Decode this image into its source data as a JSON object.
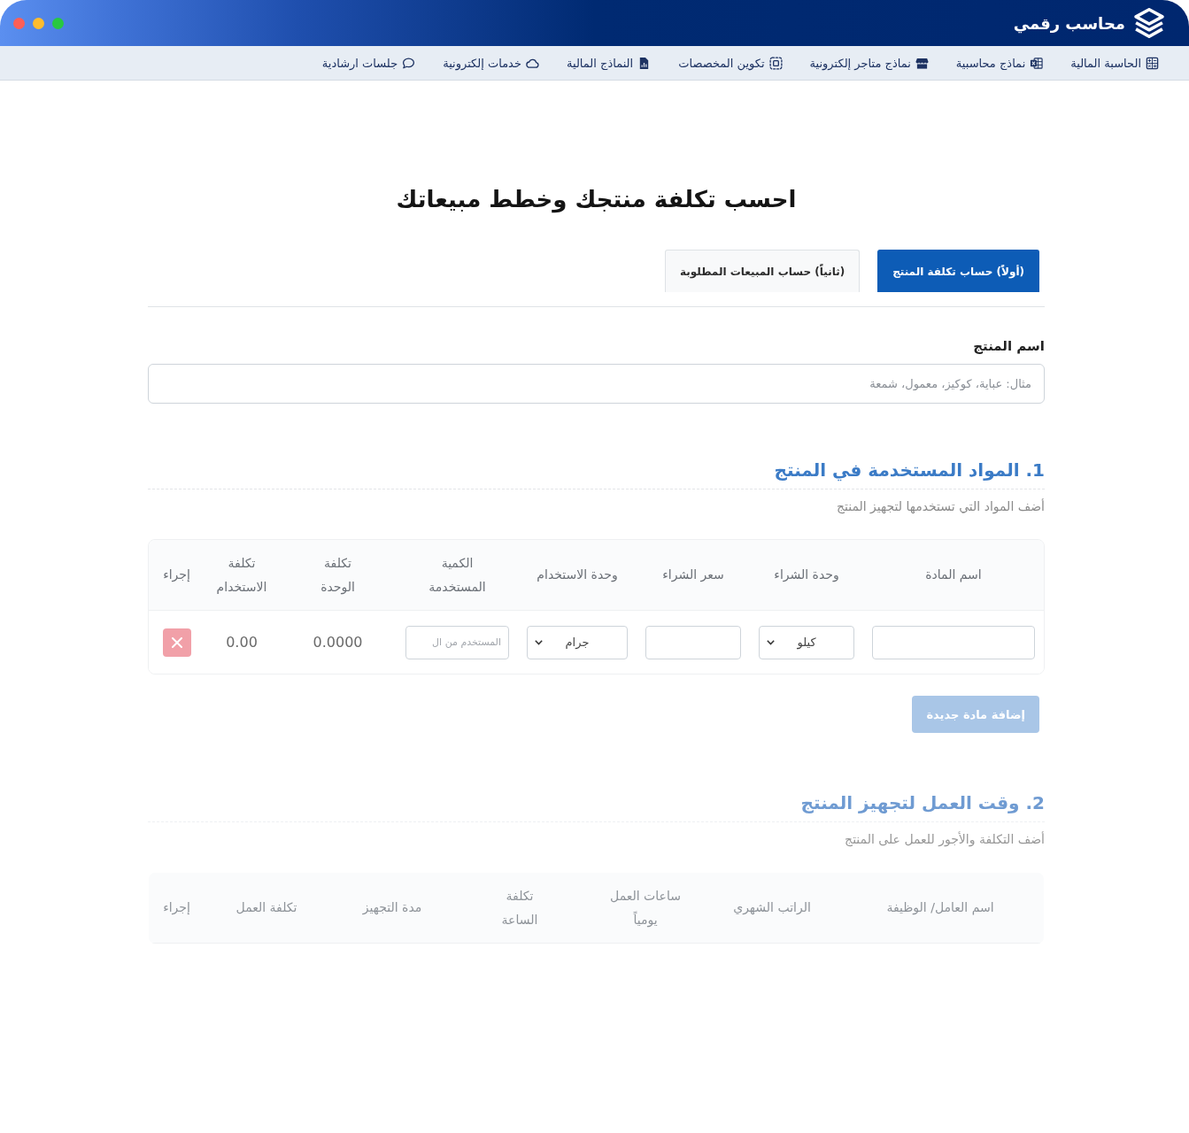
{
  "window": {
    "title": "محاسب رقمي"
  },
  "nav": [
    {
      "label": "الحاسبة المالية"
    },
    {
      "label": "نماذج محاسبية"
    },
    {
      "label": "نماذج متاجر إلكترونية"
    },
    {
      "label": "تكوين المخصصات"
    },
    {
      "label": "النماذج المالية"
    },
    {
      "label": "خدمات إلكترونية"
    },
    {
      "label": "جلسات ارشادية"
    }
  ],
  "page_title": "احسب تكلفة منتجك وخطط مبيعاتك",
  "tabs": [
    {
      "label": "(أولاً) حساب تكلفة المنتج",
      "selected": true
    },
    {
      "label": "(ثانياً) حساب المبيعات المطلوبة",
      "selected": false
    }
  ],
  "product_name": {
    "label": "اسم المنتج",
    "placeholder": "مثال: عباية، كوكيز، معمول، شمعة"
  },
  "sections": [
    {
      "title": "1. المواد المستخدمة في المنتج",
      "subtitle": "أضف المواد التي تستخدمها لتجهيز المنتج",
      "faded": false,
      "table": {
        "columns": [
          "اسم المادة",
          "وحدة الشراء",
          "سعر الشراء",
          "وحدة الاستخدام",
          "الكمية المستخدمة",
          "تكلفة الوحدة",
          "تكلفة الاستخدام",
          "إجراء"
        ],
        "rows": [
          [
            {
              "kind": "input"
            },
            {
              "kind": "select",
              "value": "كيلو"
            },
            {
              "kind": "input"
            },
            {
              "kind": "select",
              "value": "جرام"
            },
            {
              "kind": "input",
              "placeholder": "المستخدم من ال"
            },
            {
              "kind": "text",
              "value": "0.0000"
            },
            {
              "kind": "text",
              "value": "0.00"
            },
            {
              "kind": "delete"
            }
          ]
        ]
      },
      "add_button": "إضافة مادة جديدة"
    },
    {
      "title": "2. وقت العمل لتجهيز المنتج",
      "subtitle": "أضف التكلفة والأجور للعمل على المنتج",
      "faded": true,
      "table": {
        "columns": [
          "اسم العامل/ الوظيفة",
          "الراتب الشهري",
          "ساعات العمل يومياً",
          "تكلفة الساعة",
          "مدة التجهيز",
          "تكلفة العمل",
          "إجراء"
        ]
      }
    }
  ]
}
